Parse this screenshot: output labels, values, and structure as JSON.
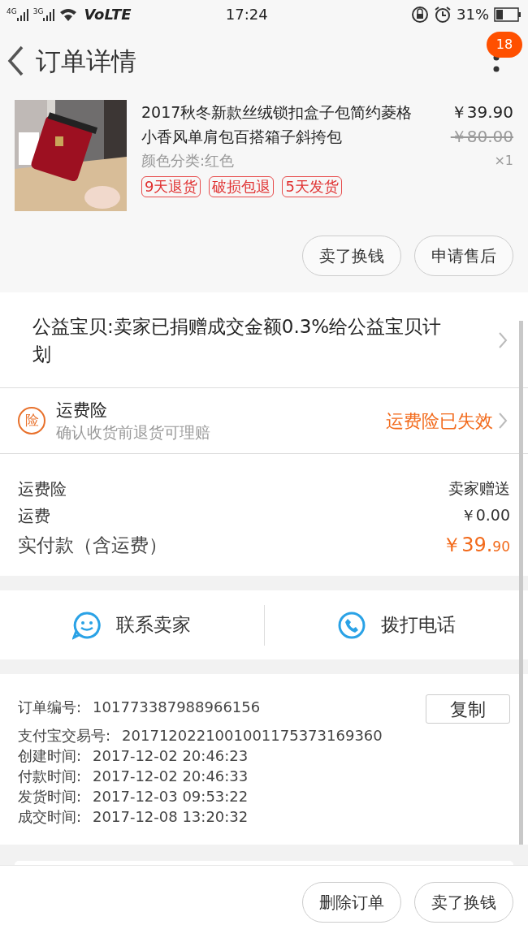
{
  "status_bar": {
    "network_1": "4G",
    "network_2": "3G",
    "volte": "VoLTE",
    "time": "17:24",
    "battery": "31%"
  },
  "header": {
    "title": "订单详情",
    "badge": "18"
  },
  "product": {
    "title": "2017秋冬新款丝绒锁扣盒子包简约菱格小香风单肩包百搭箱子斜挎包",
    "variant": "颜色分类:红色",
    "price": "￥39.90",
    "original_price": "￥80.00",
    "quantity": "×1",
    "tags": [
      "9天退货",
      "破损包退",
      "5天发货"
    ]
  },
  "item_buttons": [
    "卖了换钱",
    "申请售后"
  ],
  "charity": {
    "text": "公益宝贝:卖家已捐赠成交金额0.3%给公益宝贝计划"
  },
  "insurance": {
    "icon_text": "险",
    "title": "运费险",
    "subtitle": "确认收货前退货可理赔",
    "status": "运费险已失效"
  },
  "fees": [
    {
      "label": "运费险",
      "value": "卖家赠送",
      "kind": "plain"
    },
    {
      "label": "运费",
      "value": "￥0.00",
      "kind": "plain"
    },
    {
      "label": "实付款（含运费）",
      "value": "￥39.",
      "value_small": "90",
      "kind": "total"
    }
  ],
  "contact": [
    {
      "label": "联系卖家",
      "kind": "chat"
    },
    {
      "label": "拨打电话",
      "kind": "phone"
    }
  ],
  "order_info": {
    "copy_button": "复制",
    "rows": [
      {
        "label": "订单编号:",
        "value": "101773387988966156"
      },
      {
        "label": "支付宝交易号:",
        "value": "2017120221001001175373169360"
      },
      {
        "label": "创建时间:",
        "value": "2017-12-02 20:46:23"
      },
      {
        "label": "付款时间:",
        "value": "2017-12-02 20:46:33"
      },
      {
        "label": "发货时间:",
        "value": "2017-12-03 09:53:22"
      },
      {
        "label": "成交时间:",
        "value": "2017-12-08 13:20:32"
      }
    ]
  },
  "bottom_buttons": [
    "删除订单",
    "卖了换钱"
  ]
}
